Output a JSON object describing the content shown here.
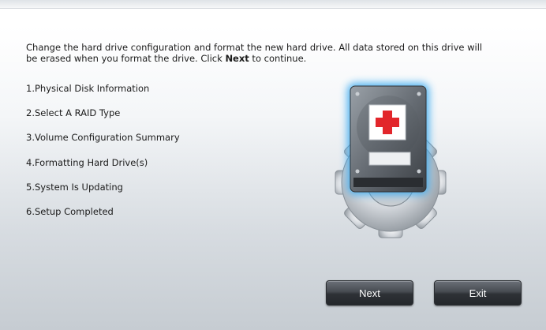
{
  "intro": {
    "text_before": "Change the hard drive configuration and format the new hard drive. All data stored on this drive will be erased when you format the drive. Click ",
    "emphasis": "Next",
    "text_after": " to continue."
  },
  "steps": [
    "1.Physical Disk Information",
    "2.Select A RAID Type",
    "3.Volume Configuration Summary",
    "4.Formatting Hard Drive(s)",
    "5.System Is Updating",
    "6.Setup Completed"
  ],
  "illustration": {
    "icon": "hard-drive-repair-gear-icon",
    "accent_color": "#e2262b",
    "glow_color": "#35a8f0"
  },
  "buttons": {
    "next_label": "Next",
    "exit_label": "Exit"
  }
}
